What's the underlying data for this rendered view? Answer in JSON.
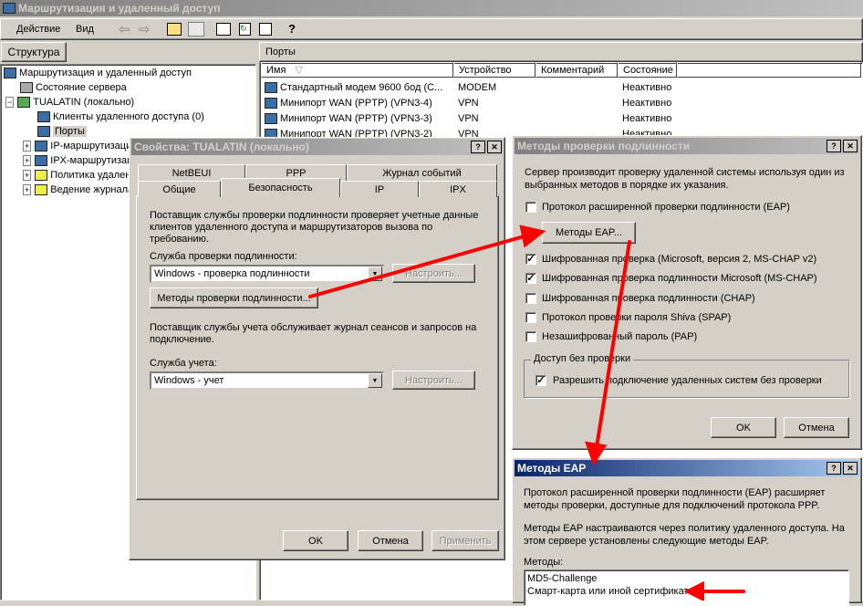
{
  "app": {
    "title": "Маршрутизация и удаленный доступ"
  },
  "menu": {
    "action": "Действие",
    "view": "Вид"
  },
  "left": {
    "tab": "Структура",
    "tree": [
      "Маршрутизация и удаленный доступ",
      "Состояние сервера",
      "TUALATIN (локально)",
      "Клиенты удаленного доступа (0)",
      "Порты",
      "IP-маршрутизация",
      "IPX-маршрутизация",
      "Политика удаленного доступа",
      "Ведение журнала"
    ]
  },
  "right": {
    "header": "Порты",
    "columns": [
      "Имя",
      "Устройство",
      "Комментарий",
      "Состояние"
    ],
    "rows": [
      {
        "name": "Стандартный модем  9600 бод (C...",
        "device": "MODEM",
        "comment": "",
        "state": "Неактивно"
      },
      {
        "name": "Минипорт WAN (PPTP) (VPN3-4)",
        "device": "VPN",
        "comment": "",
        "state": "Неактивно"
      },
      {
        "name": "Минипорт WAN (PPTP) (VPN3-3)",
        "device": "VPN",
        "comment": "",
        "state": "Неактивно"
      },
      {
        "name": "Минипорт WAN (PPTP) (VPN3-2)",
        "device": "VPN",
        "comment": "",
        "state": "Неактивно"
      }
    ]
  },
  "props": {
    "title": "Свойства: TUALATIN (локально)",
    "tabs_row1": [
      "NetBEUI",
      "PPP",
      "Журнал событий"
    ],
    "tabs_row2": [
      "Общие",
      "Безопасность",
      "IP",
      "IPX"
    ],
    "desc1": "Поставщик службы проверки подлинности проверяет учетные данные клиентов удаленного доступа и маршрутизаторов вызова по требованию.",
    "auth_label": "Служба проверки подлинности:",
    "auth_value": "Windows - проверка подлинности",
    "configure": "Настроить...",
    "auth_methods": "Методы проверки подлинности...",
    "desc2": "Поставщик службы учета обслуживает журнал сеансов и запросов на подключение.",
    "acct_label": "Служба учета:",
    "acct_value": "Windows - учет",
    "ok": "OK",
    "cancel": "Отмена",
    "apply": "Применить"
  },
  "auth": {
    "title": "Методы проверки подлинности",
    "desc": "Сервер производит проверку удаленной системы используя один из выбранных методов в порядке их указания.",
    "options": [
      {
        "label": "Протокол расширенной проверки подлинности (EAP)",
        "checked": false
      },
      {
        "label": "Шифрованная проверка (Microsoft, версия 2, MS-CHAP v2)",
        "checked": true
      },
      {
        "label": "Шифрованная проверка подлинности Microsoft (MS-CHAP)",
        "checked": true
      },
      {
        "label": "Шифрованная проверка подлинности (CHAP)",
        "checked": false
      },
      {
        "label": "Протокол проверки пароля Shiva (SPAP)",
        "checked": false
      },
      {
        "label": "Незашифрованный пароль (PAP)",
        "checked": false
      }
    ],
    "eap_button": "Методы EAP...",
    "group": "Доступ без проверки",
    "allow": "Разрешить подключение удаленных систем без проверки",
    "allow_checked": true,
    "ok": "OK",
    "cancel": "Отмена"
  },
  "eap": {
    "title": "Методы EAP",
    "desc1": "Протокол расширенной проверки подлинности (EAP) расширяет методы проверки, доступные для подключений протокола PPP.",
    "desc2": "Методы EAP настраиваются через политику удаленного доступа. На этом сервере установлены следующие методы EAP.",
    "methods_label": "Методы:",
    "methods": [
      "MD5-Challenge",
      "Смарт-карта или иной сертификат"
    ]
  },
  "colors": {
    "annotation": "#ff0000",
    "active_title": "#0a246a"
  }
}
